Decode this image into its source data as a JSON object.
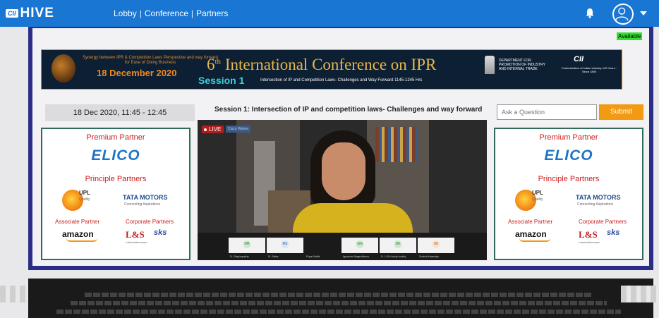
{
  "header": {
    "logo_prefix": "CII",
    "logo_text": "HIVE",
    "nav": [
      "Lobby",
      "Conference",
      "Partners"
    ],
    "nav_sep": "|"
  },
  "status": {
    "available": "Available"
  },
  "banner": {
    "tagline": "Synergy between IPR & Competition Laws Perspective and way forward for Ease of Doing Business",
    "date": "18 December 2020",
    "conference_ordinal": "6",
    "conference_ordinal_suffix": "th",
    "conference_title": "International Conference on IPR",
    "session": "Session 1",
    "session_subtitle": "Intersection of IP and Competition Laws- Challenges and Way Forward 1145-1245 Hrs",
    "dept_text": "DEPARTMENT FOR PROMOTION OF INDUSTRY AND INTERNAL TRADE",
    "cii_logo": "CII",
    "cii_text": "Confederation of Indian Industry 125 Years - Since 1895"
  },
  "schedule": {
    "datetime": "18 Dec 2020, 11:45 - 12:45"
  },
  "video": {
    "title": "Session 1: Intersection of IP and competition laws- Challenges and way forward",
    "live_label": "LIVE",
    "live_tag": "Cisco Webex",
    "participants": [
      {
        "initials": "DR",
        "name": "D. Raghupathy"
      },
      {
        "initials": "RS",
        "name": "R. Saha"
      },
      {
        "initials": "",
        "name": "Pryal Malik"
      },
      {
        "initials": "GN",
        "name": "Ignasimi Nagudhana"
      },
      {
        "initials": "DK",
        "name": "D. LSI Kuddy kuddy"
      },
      {
        "initials": "SK",
        "name": "Surbhi khandey"
      }
    ]
  },
  "question": {
    "placeholder": "Ask a Question",
    "submit_label": "Submit"
  },
  "partners": {
    "premium_heading": "Premium Partner",
    "premium_brand": "ELICO",
    "principle_heading": "Principle Partners",
    "upl": "UPL",
    "upl_sub": "Quality",
    "tata": "TATA MOTORS",
    "tata_sub": "Connecting Aspirations",
    "associate_heading": "Associate Partner",
    "amazon": "amazon",
    "corporate_heading": "Corporate Partners",
    "ls": "L&S",
    "ls_sub": "Lakshmikumaran",
    "sks": "sks"
  },
  "colors": {
    "topbar": "#1976d2",
    "stage": "#2b2e86",
    "partner_heading": "#cc1e1e",
    "submit": "#f29a12"
  }
}
